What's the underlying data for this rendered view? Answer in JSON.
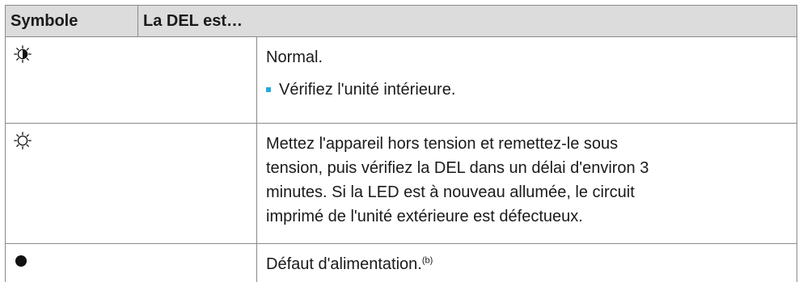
{
  "table": {
    "headers": [
      "Symbole",
      "La DEL est…"
    ],
    "rows": [
      {
        "symbol_icon": "half-lit-led-icon",
        "text": "Normal.",
        "bullet": "Vérifiez l'unité intérieure."
      },
      {
        "symbol_icon": "led-on-icon",
        "text_lines": [
          "Mettez l'appareil hors tension et remettez-le sous",
          "tension, puis vérifiez la DEL dans un délai d'environ 3",
          "minutes. Si la LED est à nouveau allumée, le circuit",
          "imprimé de l'unité extérieure est défectueux."
        ]
      },
      {
        "symbol_icon": "led-off-icon",
        "text": "Défaut d'alimentation.",
        "superscript": "(b)"
      }
    ]
  },
  "colors": {
    "header_bg": "#dcdcdc",
    "border": "#8a8a8a",
    "bullet": "#26a9e0"
  }
}
